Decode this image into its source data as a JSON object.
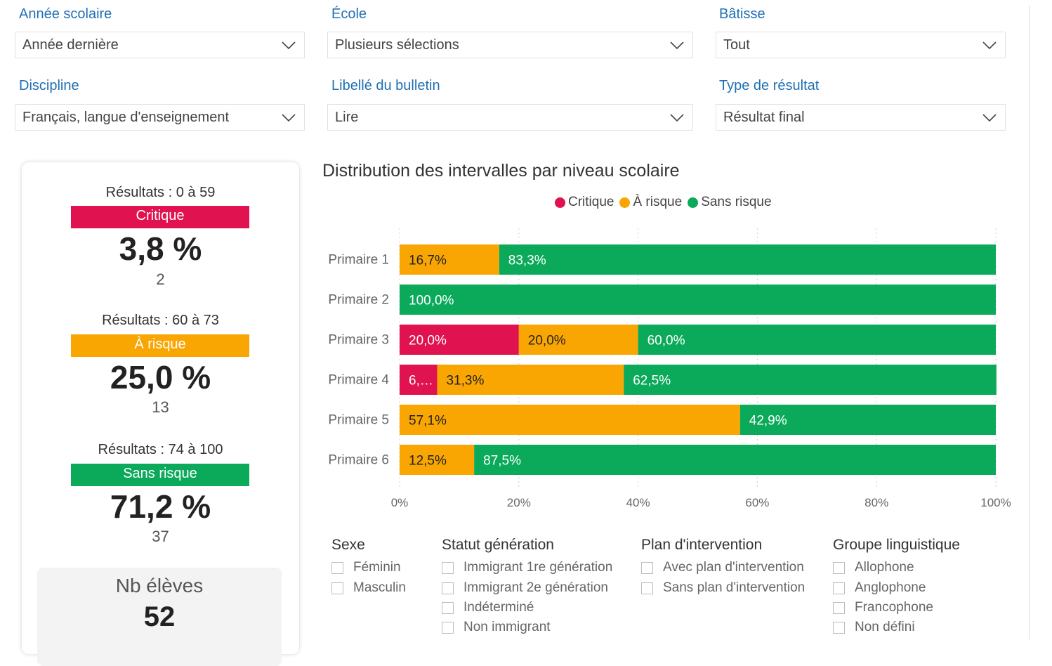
{
  "filters": [
    {
      "label": "Année scolaire",
      "value": "Année dernière"
    },
    {
      "label": "École",
      "value": "Plusieurs sélections"
    },
    {
      "label": "Bâtisse",
      "value": "Tout"
    },
    {
      "label": "Discipline",
      "value": "Français, langue d'enseignement"
    },
    {
      "label": "Libellé du bulletin",
      "value": "Lire"
    },
    {
      "label": "Type de résultat",
      "value": "Résultat final"
    }
  ],
  "kpis": [
    {
      "range": "Résultats : 0 à 59",
      "band": "Critique",
      "pct": "3,8 %",
      "count": "2",
      "color": "#e0124f"
    },
    {
      "range": "Résultats : 60 à 73",
      "band": "À risque",
      "pct": "25,0 %",
      "count": "13",
      "color": "#f9a602"
    },
    {
      "range": "Résultats : 74 à 100",
      "band": "Sans risque",
      "pct": "71,2 %",
      "count": "37",
      "color": "#0aaa5a"
    }
  ],
  "nb_eleves": {
    "label": "Nb élèves",
    "value": "52"
  },
  "chart_data": {
    "type": "bar",
    "orientation": "horizontal-stacked-100",
    "title": "Distribution des intervalles par niveau scolaire",
    "categories": [
      "Primaire 1",
      "Primaire 2",
      "Primaire 3",
      "Primaire 4",
      "Primaire 5",
      "Primaire 6"
    ],
    "series": [
      {
        "name": "Critique",
        "color": "#e0124f",
        "values": [
          0,
          0,
          20.0,
          6.3,
          0,
          0
        ],
        "labels": [
          "",
          "",
          "20,0%",
          "6,…",
          "",
          ""
        ]
      },
      {
        "name": "À risque",
        "color": "#f9a602",
        "values": [
          16.7,
          0,
          20.0,
          31.3,
          57.1,
          12.5
        ],
        "labels": [
          "16,7%",
          "",
          "20,0%",
          "31,3%",
          "57,1%",
          "12,5%"
        ]
      },
      {
        "name": "Sans risque",
        "color": "#0aaa5a",
        "values": [
          83.3,
          100.0,
          60.0,
          62.5,
          42.9,
          87.5
        ],
        "labels": [
          "83,3%",
          "100,0%",
          "60,0%",
          "62,5%",
          "42,9%",
          "87,5%"
        ]
      }
    ],
    "xticks": [
      "0%",
      "20%",
      "40%",
      "60%",
      "80%",
      "100%"
    ],
    "xlim": [
      0,
      100
    ],
    "legend_position": "top-center",
    "grid": true
  },
  "slicers": [
    {
      "title": "Sexe",
      "options": [
        "Féminin",
        "Masculin"
      ]
    },
    {
      "title": "Statut génération",
      "options": [
        "Immigrant 1re génération",
        "Immigrant 2e génération",
        "Indéterminé",
        "Non immigrant"
      ]
    },
    {
      "title": "Plan d'intervention",
      "options": [
        "Avec plan d'intervention",
        "Sans plan d'intervention"
      ]
    },
    {
      "title": "Groupe linguistique",
      "options": [
        "Allophone",
        "Anglophone",
        "Francophone",
        "Non défini"
      ]
    }
  ]
}
